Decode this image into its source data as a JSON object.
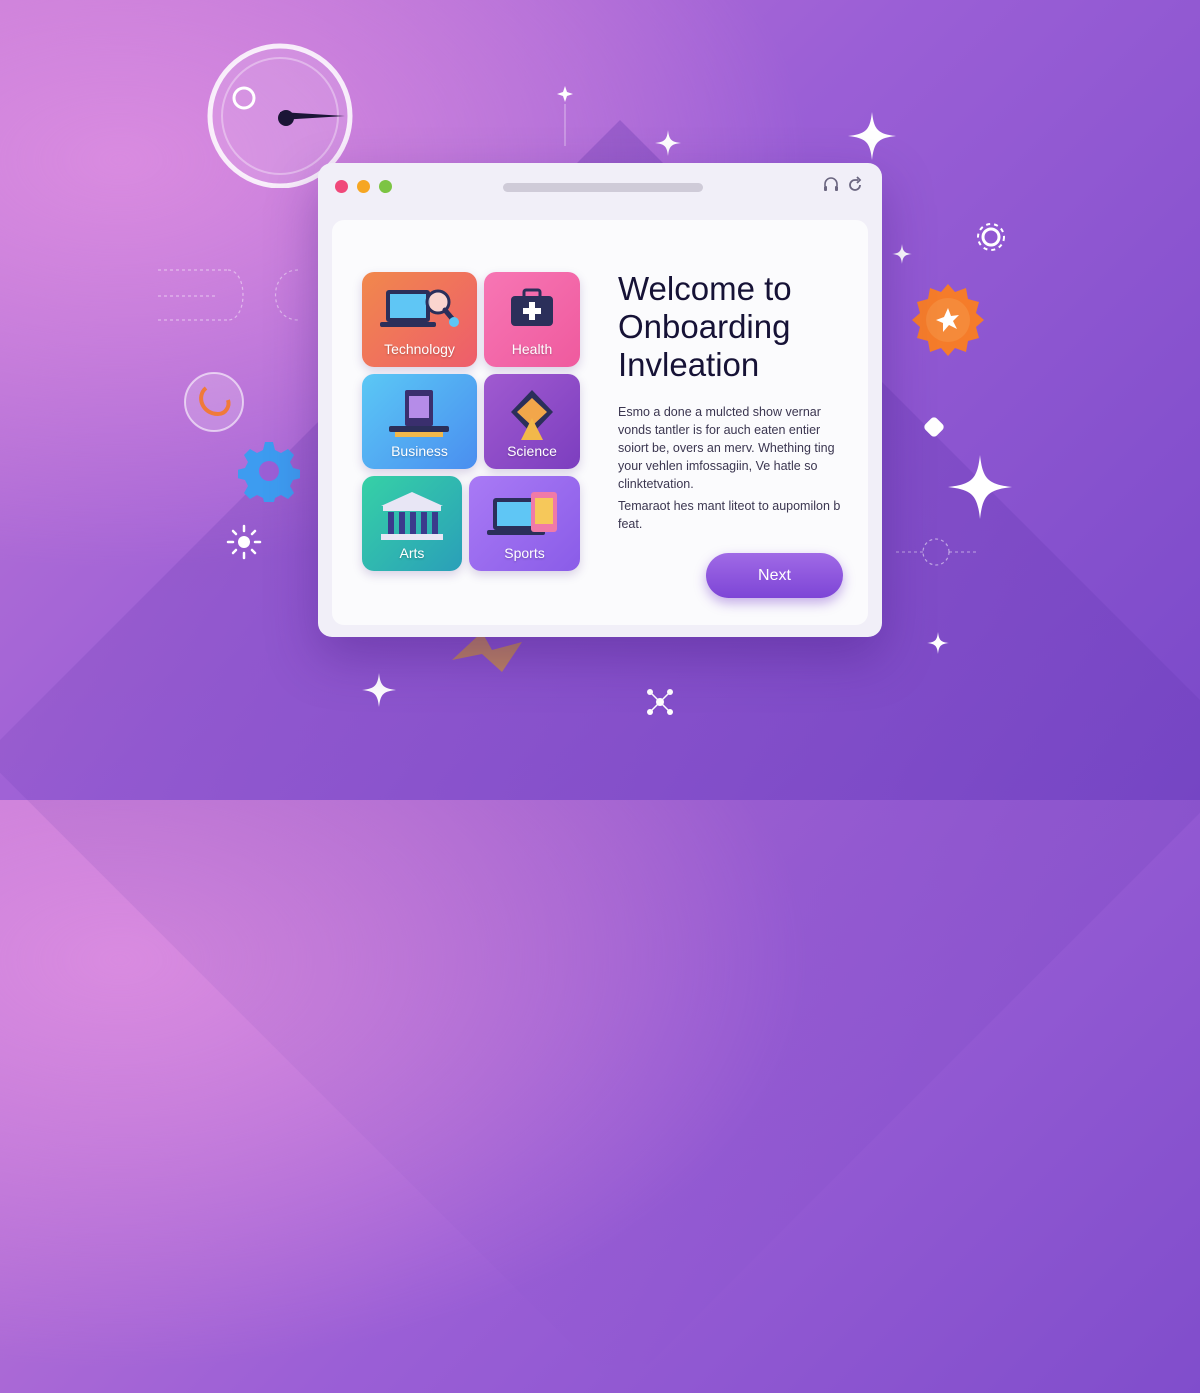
{
  "window": {
    "traffic_lights": [
      "#f0487a",
      "#f6a623",
      "#7cc443"
    ],
    "toolbar_icons": [
      "headset-icon",
      "refresh-icon"
    ]
  },
  "categories": [
    {
      "id": "technology",
      "label": "Technology",
      "icon": "laptop-magnifier-icon"
    },
    {
      "id": "health",
      "label": "Health",
      "icon": "medical-kit-icon"
    },
    {
      "id": "business",
      "label": "Business",
      "icon": "document-stack-icon"
    },
    {
      "id": "science",
      "label": "Science",
      "icon": "geometric-shape-icon"
    },
    {
      "id": "arts",
      "label": "Arts",
      "icon": "museum-icon"
    },
    {
      "id": "sports",
      "label": "Sports",
      "icon": "devices-icon"
    }
  ],
  "welcome": {
    "title_lines": [
      "Welcome to",
      "Onboarding",
      "Invleation"
    ],
    "paragraph1": "Esmo a done a mulcted show vernar vonds tantler is for auch eaten entier soiort be, overs an merv. Whething ting your vehlen imfossagiin, Ve hatle so clinktetvation.",
    "paragraph2": "Temaraot hes mant liteot to aupomilon b feat."
  },
  "actions": {
    "next_label": "Next"
  },
  "colors": {
    "accent": "#8f55df",
    "background": "#9b5fd6"
  }
}
